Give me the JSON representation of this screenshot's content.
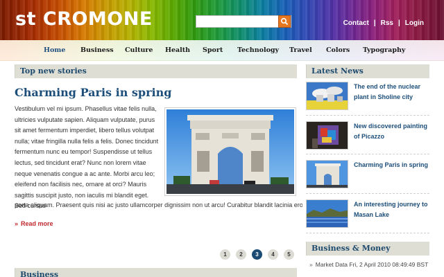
{
  "header": {
    "logo": "st CROMONE",
    "search": {
      "placeholder": ""
    },
    "links": [
      "Contact",
      "Rss",
      "Login"
    ]
  },
  "nav": {
    "items": [
      "Home",
      "Business",
      "Culture",
      "Health",
      "Sport",
      "Technology",
      "Travel",
      "Colors",
      "Typography"
    ],
    "active": "Home"
  },
  "main": {
    "section_title": "Top new stories",
    "article": {
      "title": "Charming Paris in spring",
      "body": "Vestibulum vel mi ipsum. Phasellus vitae felis nulla, ultricies vulputate sapien. Aliquam vulputate, purus sit amet fermentum imperdiet, libero tellus volutpat nulla; vitae fringilla nulla felis a felis. Donec tincidunt fermentum nunc eu tempor! Suspendisse ut tellus lectus, sed tincidunt erat? Nunc non lorem vitae neque venenatis congue a ac ante. Morbi arcu leo; eleifend non facilisis nec, ornare at orci? Mauris sagittis suscipit justo, non iaculis mi blandit eget. Sed cursus",
      "body_last": "porta aliquam. Praesent quis nisi ac justo ullamcorper dignissim non ut arcu! Curabitur blandit lacinia eros ac",
      "read_more": "Read more"
    },
    "pagination": [
      "1",
      "2",
      "3",
      "4",
      "5"
    ],
    "active_page": "3",
    "next_section_title": "Business"
  },
  "sidebar": {
    "latest_news_title": "Latest News",
    "news": [
      {
        "title": "The end of the nuclear plant in Sholine city"
      },
      {
        "title": "New discovered painting of Picazzo"
      },
      {
        "title": "Charming Paris in spring"
      },
      {
        "title": "An interesting journey to Masan Lake"
      }
    ],
    "business_title": "Business & Money",
    "market": "Market Data Fri, 2 April 2010 08:49:49 BST"
  },
  "colors": {
    "accent": "#1c4e7a",
    "link_red": "#c1272d",
    "section_bg": "#deded4",
    "search_button": "#e87722"
  }
}
